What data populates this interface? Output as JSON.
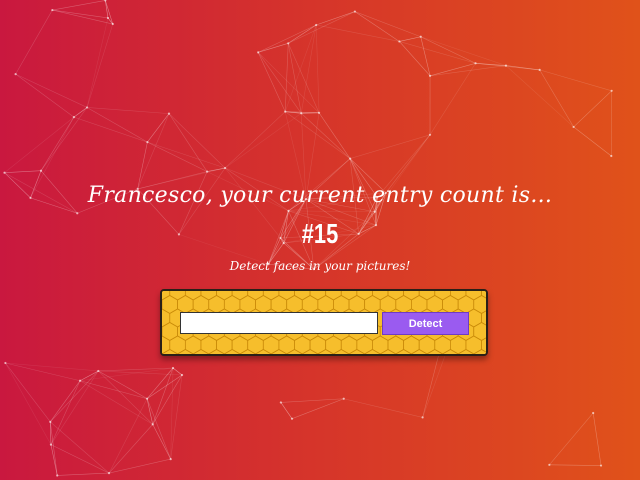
{
  "header": {
    "greeting": "Francesco, your current entry count is...",
    "entry_count": "#15",
    "tagline": "Detect faces in your pictures!"
  },
  "form": {
    "input_value": "",
    "detect_label": "Detect"
  },
  "colors": {
    "background_start": "#c9183f",
    "background_end": "#e0521a",
    "panel": "#f4b21a",
    "button": "#9a5bf0",
    "text": "#ffffff"
  }
}
